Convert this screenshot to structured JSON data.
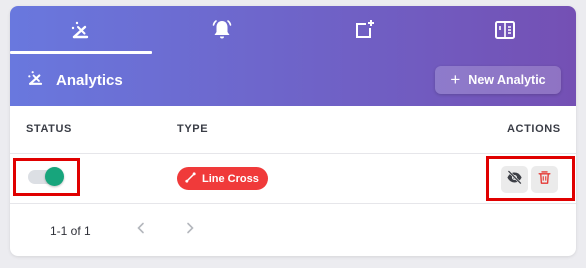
{
  "tabs": [
    {
      "icon": "analytics-wand-icon",
      "selected": true
    },
    {
      "icon": "bell-icon",
      "selected": false
    },
    {
      "icon": "add-zone-icon",
      "selected": false
    },
    {
      "icon": "calendar-grid-icon",
      "selected": false
    }
  ],
  "header": {
    "title": "Analytics",
    "icon": "analytics-wand-icon",
    "new_button_label": "New Analytic"
  },
  "table": {
    "columns": [
      "STATUS",
      "TYPE",
      "ACTIONS"
    ],
    "rows": [
      {
        "status_enabled": true,
        "type_label": "Line Cross",
        "type_icon": "line-cross-icon",
        "actions": [
          "hide-icon",
          "delete-icon"
        ]
      }
    ]
  },
  "pagination": {
    "range_text": "1-1 of 1"
  },
  "colors": {
    "header_gradient_start": "#6978de",
    "header_gradient_end": "#7450b4",
    "toggle_on": "#17a57c",
    "chip_red": "#f03a3a",
    "delete_red": "#e53935",
    "highlight_red": "#e00000"
  }
}
